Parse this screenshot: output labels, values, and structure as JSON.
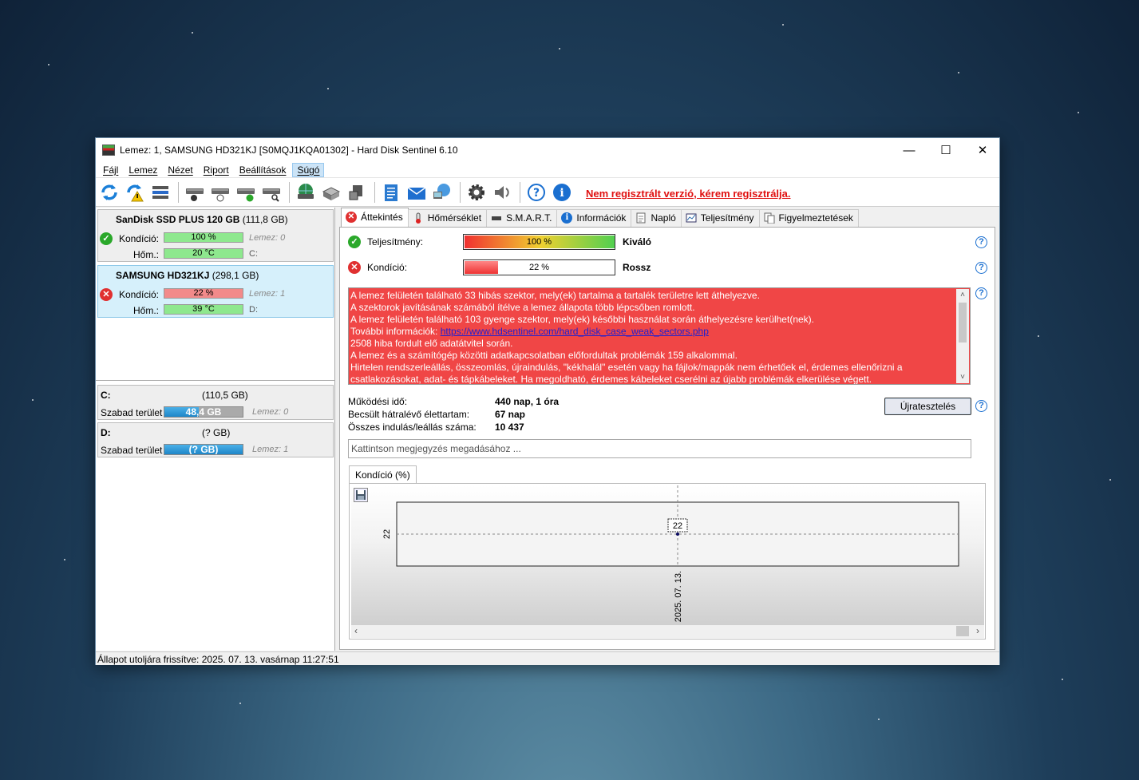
{
  "window": {
    "title": "Lemez: 1, SAMSUNG HD321KJ [S0MQJ1KQA01302]  -  Hard Disk Sentinel 6.10",
    "controls": {
      "minimize": "—",
      "maximize": "☐",
      "close": "✕"
    }
  },
  "menu": [
    "Fájl",
    "Lemez",
    "Nézet",
    "Riport",
    "Beállítások",
    "Súgó"
  ],
  "menu_selected": "Súgó",
  "toolbar": {
    "icons": [
      "refresh-icon",
      "refresh-warning-icon",
      "disk-list-icon",
      "disk-info-icon",
      "disk-timer-icon",
      "disk-check-icon",
      "disk-search-icon",
      "network-disk-icon",
      "disk-stack-icon",
      "disk-usb-icon",
      "report-icon",
      "email-icon",
      "network-icon",
      "settings-icon",
      "sound-icon",
      "help-icon",
      "about-icon"
    ],
    "register_link": "Nem regisztrált verzió, kérem regisztrálja."
  },
  "disks": [
    {
      "name": "SanDisk SSD PLUS 120 GB",
      "size": "(111,8 GB)",
      "status": "ok",
      "health_label": "Kondíció:",
      "health": "100 %",
      "health_pct": 100,
      "health_extra": "Lemez: 0",
      "temp_label": "Hőm.:",
      "temp": "20 °C",
      "temp_extra": "C:"
    },
    {
      "name": "SAMSUNG HD321KJ",
      "size": "(298,1 GB)",
      "status": "bad",
      "health_label": "Kondíció:",
      "health": "22 %",
      "health_pct": 22,
      "health_extra": "Lemez: 1",
      "temp_label": "Hőm.:",
      "temp": "39 °C",
      "temp_extra": "D:"
    }
  ],
  "volumes": [
    {
      "label": "C:",
      "size": "(110,5 GB)",
      "free_label": "Szabad terület",
      "free": "48,4 GB",
      "free_pct": 44,
      "extra": "Lemez: 0"
    },
    {
      "label": "D:",
      "size": "(? GB)",
      "free_label": "Szabad terület",
      "free": "(? GB)",
      "free_pct": 100,
      "extra": "Lemez: 1"
    }
  ],
  "tabs": [
    "Áttekintés",
    "Hőmérséklet",
    "S.M.A.R.T.",
    "Információk",
    "Napló",
    "Teljesítmény",
    "Figyelmeztetések"
  ],
  "active_tab": "Áttekintés",
  "overview": {
    "performance": {
      "label": "Teljesítmény:",
      "value": "100 %",
      "pct": 100,
      "result": "Kiváló"
    },
    "health": {
      "label": "Kondíció:",
      "value": "22 %",
      "pct": 22,
      "result": "Rossz"
    },
    "messages": [
      "A lemez felületén található 33 hibás szektor, mely(ek) tartalma a tartalék területre lett áthelyezve.",
      "A szektorok javításának számából ítélve a lemez állapota több lépcsőben romlott.",
      "A lemez felületén található 103 gyenge szektor, mely(ek) későbbi használat során áthelyezésre kerülhet(nek).",
      "2508 hiba fordult elő adatátvitel során.",
      "A lemez és a számítógép közötti adatkapcsolatban előfordultak problémák 159 alkalommal.",
      "Hirtelen rendszerleállás, összeomlás, újraindulás, \"kékhalál\" esetén vagy ha fájlok/mappák nem érhetőek el, érdemes ellenőrizni a csatlakozásokat, adat- és tápkábeleket. Ha megoldható, érdemes kábeleket cserélni az újabb problémák elkerülése végett."
    ],
    "more_info_label": "További információk: ",
    "more_info_link": "https://www.hdsentinel.com/hard_disk_case_weak_sectors.php",
    "power_on_label": "Működési idő:",
    "power_on": "440 nap, 1 óra",
    "remaining_label": "Becsült hátralévő élettartam:",
    "remaining": "67 nap",
    "starts_label": "Összes indulás/leállás száma:",
    "starts": "10 437",
    "retest_button": "Újratesztelés",
    "note_placeholder": "Kattintson megjegyzés megadásához ..."
  },
  "chart_tab": "Kondíció  (%)",
  "chart_data": {
    "type": "line",
    "x": [
      "2025. 07. 13."
    ],
    "series": [
      {
        "values": [
          22
        ]
      }
    ],
    "data_labels": [
      "22"
    ],
    "ytick_labels": [
      "22"
    ],
    "grid": true
  },
  "status_bar": "Állapot utoljára frissítve: 2025. 07. 13. vasárnap 11:27:51"
}
